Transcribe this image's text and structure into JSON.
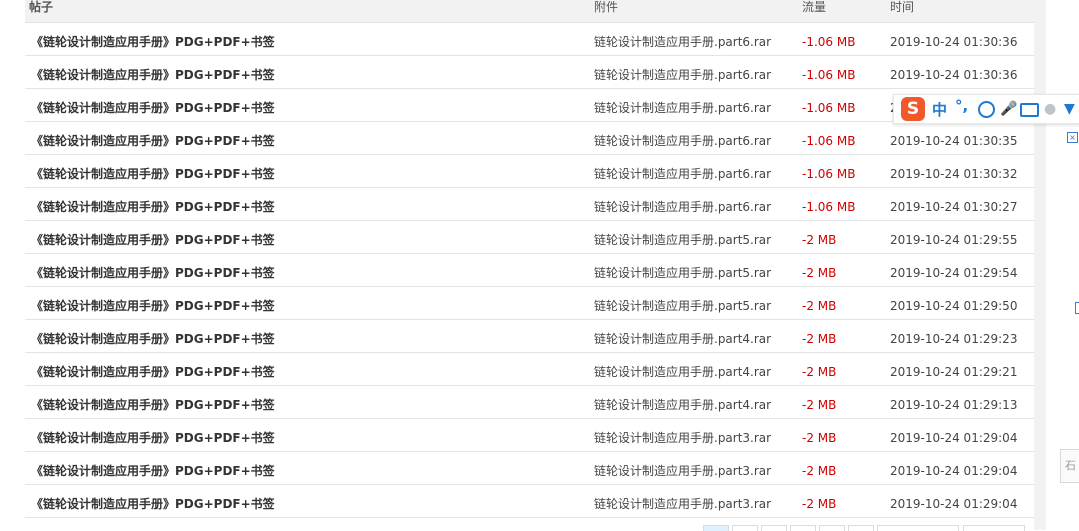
{
  "table": {
    "headers": {
      "post": "帖子",
      "attachment": "附件",
      "traffic": "流量",
      "time": "时间"
    },
    "rows": [
      {
        "post": "《链轮设计制造应用手册》PDG+PDF+书签",
        "attachment": "链轮设计制造应用手册.part6.rar",
        "traffic": "-1.06 MB",
        "time": "2019-10-24 01:30:36"
      },
      {
        "post": "《链轮设计制造应用手册》PDG+PDF+书签",
        "attachment": "链轮设计制造应用手册.part6.rar",
        "traffic": "-1.06 MB",
        "time": "2019-10-24 01:30:36"
      },
      {
        "post": "《链轮设计制造应用手册》PDG+PDF+书签",
        "attachment": "链轮设计制造应用手册.part6.rar",
        "traffic": "-1.06 MB",
        "time": "2"
      },
      {
        "post": "《链轮设计制造应用手册》PDG+PDF+书签",
        "attachment": "链轮设计制造应用手册.part6.rar",
        "traffic": "-1.06 MB",
        "time": "2019-10-24 01:30:35"
      },
      {
        "post": "《链轮设计制造应用手册》PDG+PDF+书签",
        "attachment": "链轮设计制造应用手册.part6.rar",
        "traffic": "-1.06 MB",
        "time": "2019-10-24 01:30:32"
      },
      {
        "post": "《链轮设计制造应用手册》PDG+PDF+书签",
        "attachment": "链轮设计制造应用手册.part6.rar",
        "traffic": "-1.06 MB",
        "time": "2019-10-24 01:30:27"
      },
      {
        "post": "《链轮设计制造应用手册》PDG+PDF+书签",
        "attachment": "链轮设计制造应用手册.part5.rar",
        "traffic": "-2 MB",
        "time": "2019-10-24 01:29:55"
      },
      {
        "post": "《链轮设计制造应用手册》PDG+PDF+书签",
        "attachment": "链轮设计制造应用手册.part5.rar",
        "traffic": "-2 MB",
        "time": "2019-10-24 01:29:54"
      },
      {
        "post": "《链轮设计制造应用手册》PDG+PDF+书签",
        "attachment": "链轮设计制造应用手册.part5.rar",
        "traffic": "-2 MB",
        "time": "2019-10-24 01:29:50"
      },
      {
        "post": "《链轮设计制造应用手册》PDG+PDF+书签",
        "attachment": "链轮设计制造应用手册.part4.rar",
        "traffic": "-2 MB",
        "time": "2019-10-24 01:29:23"
      },
      {
        "post": "《链轮设计制造应用手册》PDG+PDF+书签",
        "attachment": "链轮设计制造应用手册.part4.rar",
        "traffic": "-2 MB",
        "time": "2019-10-24 01:29:21"
      },
      {
        "post": "《链轮设计制造应用手册》PDG+PDF+书签",
        "attachment": "链轮设计制造应用手册.part4.rar",
        "traffic": "-2 MB",
        "time": "2019-10-24 01:29:13"
      },
      {
        "post": "《链轮设计制造应用手册》PDG+PDF+书签",
        "attachment": "链轮设计制造应用手册.part3.rar",
        "traffic": "-2 MB",
        "time": "2019-10-24 01:29:04"
      },
      {
        "post": "《链轮设计制造应用手册》PDG+PDF+书签",
        "attachment": "链轮设计制造应用手册.part3.rar",
        "traffic": "-2 MB",
        "time": "2019-10-24 01:29:04"
      },
      {
        "post": "《链轮设计制造应用手册》PDG+PDF+书签",
        "attachment": "链轮设计制造应用手册.part3.rar",
        "traffic": "-2 MB",
        "time": "2019-10-24 01:29:04"
      }
    ]
  },
  "ime_toolbar": {
    "logo": "S",
    "mode_label": "中",
    "punct_label": "°,",
    "icons": [
      "smile-icon",
      "microphone-icon",
      "keyboard-icon",
      "user-icon",
      "skin-icon"
    ]
  },
  "side_button_label": "石",
  "colors": {
    "traffic_negative": "#d10000",
    "header_bg": "#f2f2f2",
    "ime_brand": "#f1592a",
    "ime_accent": "#1f78d1"
  }
}
